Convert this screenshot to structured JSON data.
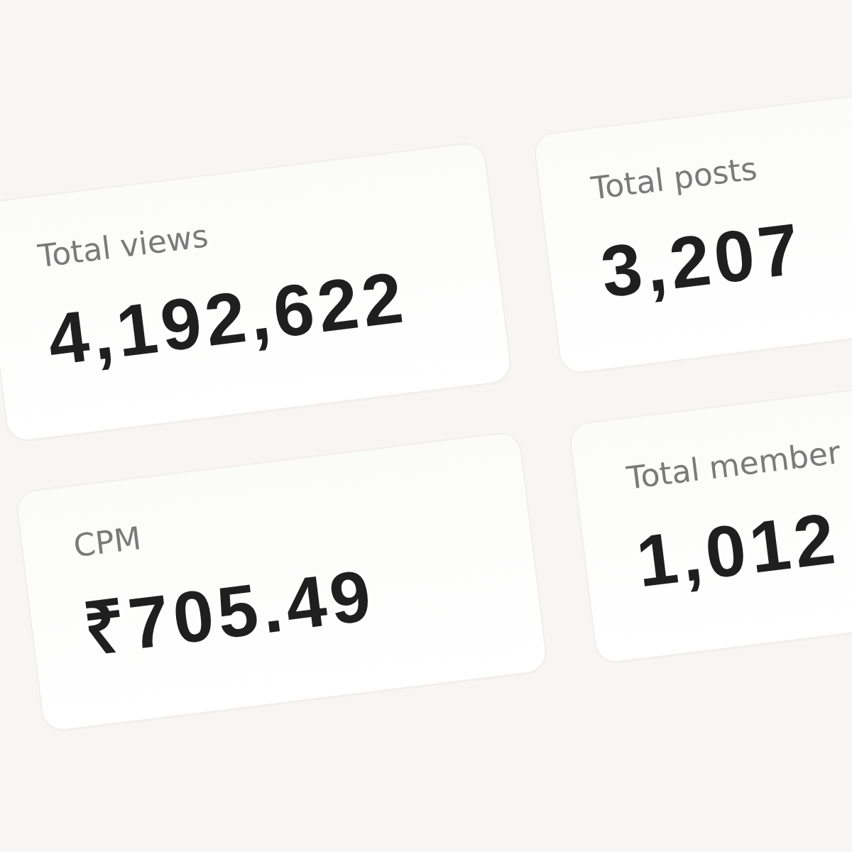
{
  "cards": [
    {
      "label": "Total views",
      "value": "4,192,622"
    },
    {
      "label": "Total posts",
      "value": "3,207"
    },
    {
      "label": "CPM",
      "value": "₹705.49"
    },
    {
      "label": "Total member",
      "value": "1,012"
    }
  ]
}
